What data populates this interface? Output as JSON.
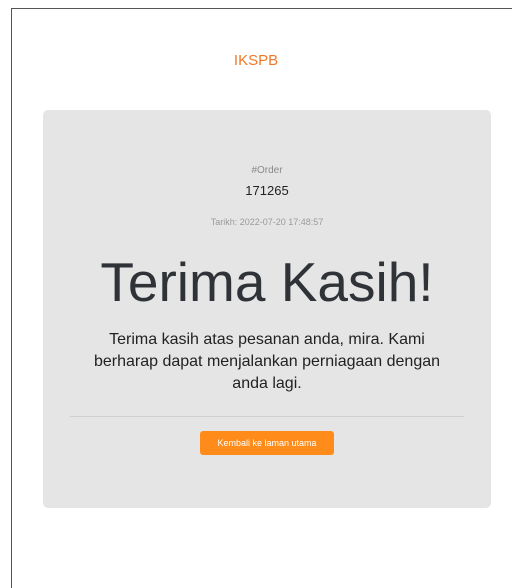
{
  "brand": {
    "name": "IKSPB"
  },
  "order": {
    "label": "#Order",
    "number": "171265",
    "date": "Tarikh: 2022-07-20 17:48:57"
  },
  "thanks": {
    "title": "Terima Kasih!",
    "message": "Terima kasih atas pesanan anda, mira. Kami berharap dapat menjalankan perniagaan dengan anda lagi."
  },
  "actions": {
    "home_label": "Kembali ke laman utama"
  },
  "colors": {
    "brand": "#f0782a",
    "button": "#ff8c1a",
    "card": "#e5e5e5"
  }
}
